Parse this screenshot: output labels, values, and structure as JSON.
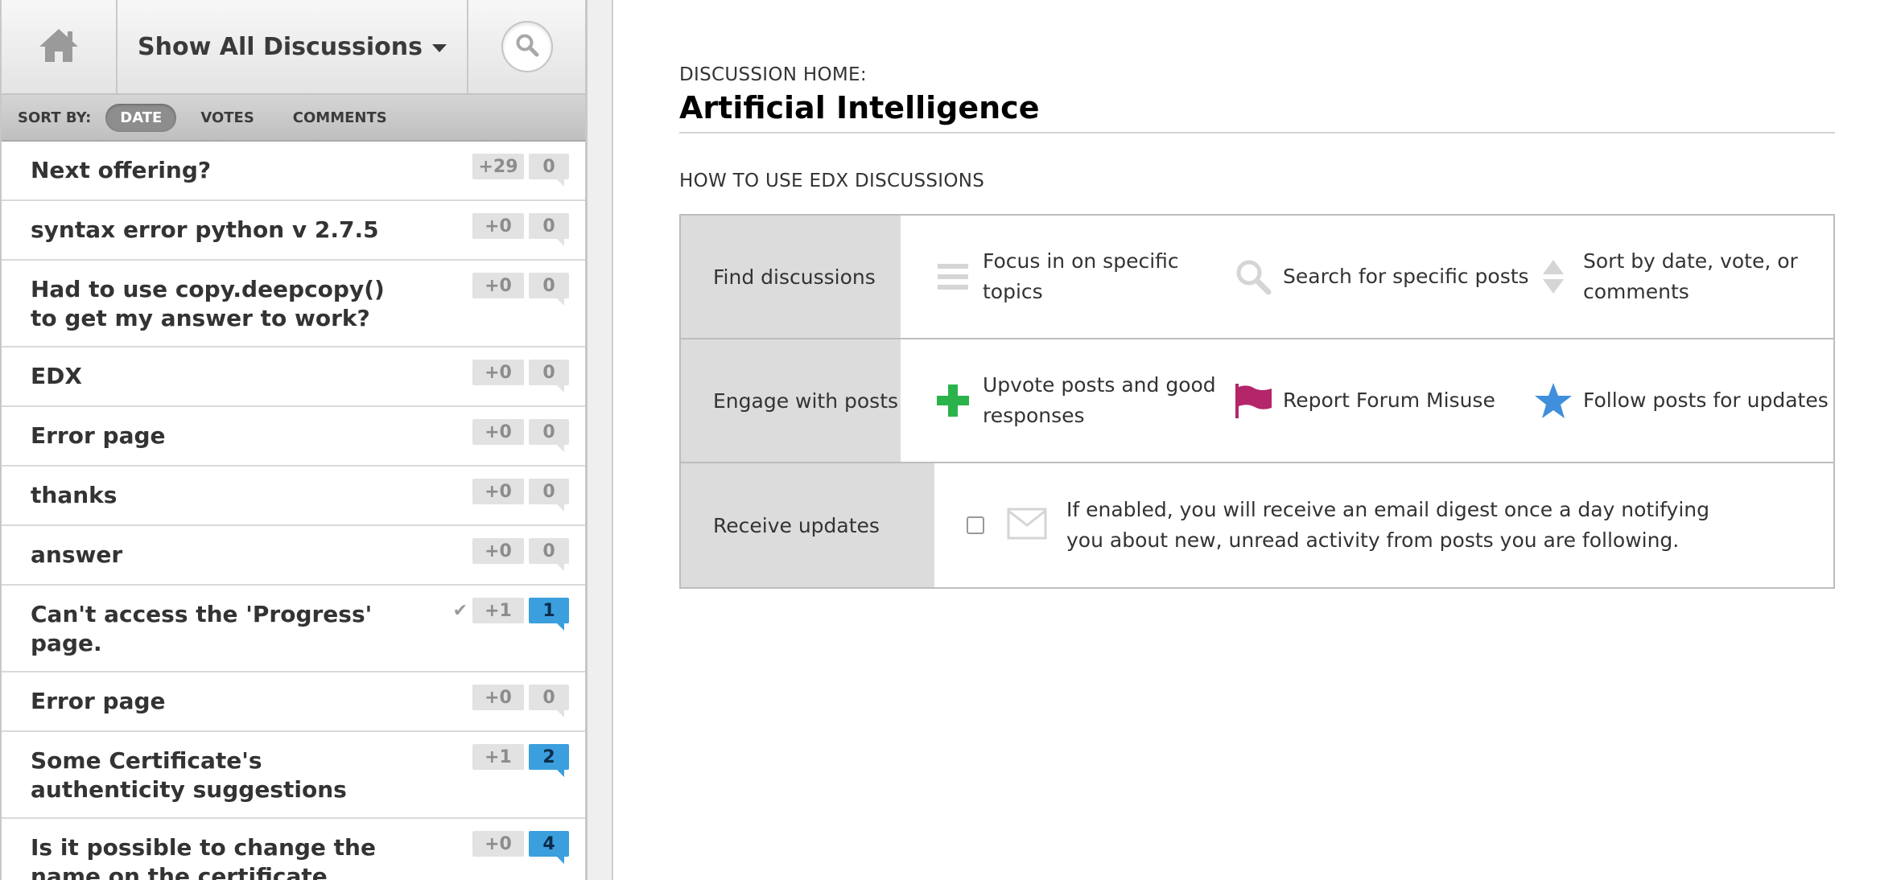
{
  "sidebar": {
    "browse_label": "Show All Discussions",
    "sort": {
      "label": "SORT BY:",
      "options": [
        "DATE",
        "VOTES",
        "COMMENTS"
      ]
    },
    "threads": [
      {
        "title": "Next offering?",
        "votes": "+29",
        "comments": "0"
      },
      {
        "title": "syntax error python v 2.7.5",
        "votes": "+0",
        "comments": "0"
      },
      {
        "title": "Had to use copy.deepcopy() to get my answer to work?",
        "votes": "+0",
        "comments": "0"
      },
      {
        "title": "EDX",
        "votes": "+0",
        "comments": "0"
      },
      {
        "title": "Error page",
        "votes": "+0",
        "comments": "0"
      },
      {
        "title": "thanks",
        "votes": "+0",
        "comments": "0"
      },
      {
        "title": "answer",
        "votes": "+0",
        "comments": "0"
      },
      {
        "title": "Can't access the 'Progress' page.",
        "votes": "+1",
        "comments": "1"
      },
      {
        "title": "Error page",
        "votes": "+0",
        "comments": "0"
      },
      {
        "title": "Some Certificate's authenticity suggestions",
        "votes": "+1",
        "comments": "2"
      },
      {
        "title": "Is it possible to change the name on the certificate",
        "votes": "+0",
        "comments": "4"
      }
    ]
  },
  "main": {
    "home_label": "DISCUSSION HOME:",
    "course_title": "Artificial Intelligence",
    "howto_title": "HOW TO USE EDX DISCUSSIONS",
    "rows": {
      "find": {
        "label": "Find discussions",
        "items": [
          "Focus in on specific topics",
          "Search for specific posts",
          "Sort by date, vote, or comments"
        ]
      },
      "engage": {
        "label": "Engage with posts",
        "items": [
          "Upvote posts and good responses",
          "Report Forum Misuse",
          "Follow posts for updates"
        ]
      },
      "receive": {
        "label": "Receive updates",
        "text": "If enabled, you will receive an email digest once a day notifying you about new, unread activity from posts you are following."
      }
    }
  },
  "colors": {
    "unread_comment": "#3b9fde",
    "upvote_green": "#2bb34b",
    "flag_magenta": "#b5256a",
    "star_blue": "#3f8fdc"
  },
  "icons": {
    "home": "home-icon",
    "search": "search-icon",
    "topics": "list-icon",
    "sort": "sort-icon",
    "upvote": "plus-icon",
    "report": "flag-icon",
    "follow": "star-icon",
    "email": "envelope-icon"
  }
}
